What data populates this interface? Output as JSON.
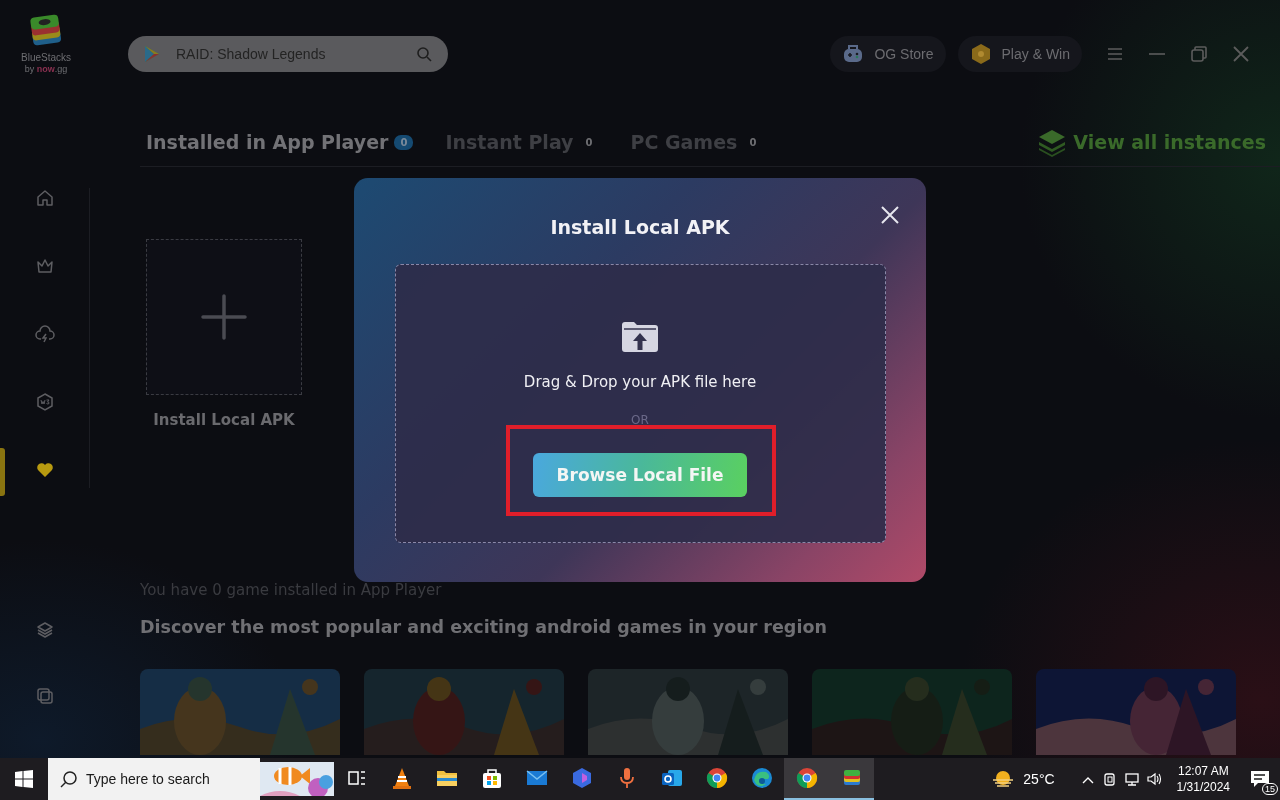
{
  "app": {
    "logo_name": "BlueStacks",
    "logo_by": "by **now**.gg"
  },
  "search": {
    "value": "RAID: Shadow Legends"
  },
  "header_buttons": [
    {
      "label": "OG Store",
      "kind": "store"
    },
    {
      "label": "Play & Win",
      "kind": "reward"
    }
  ],
  "window_controls": [
    {
      "kind": "menu"
    },
    {
      "kind": "minimize"
    },
    {
      "kind": "restore"
    },
    {
      "kind": "close"
    }
  ],
  "tabs": [
    {
      "label": "Installed in App Player",
      "count": "0",
      "selected": true
    },
    {
      "label": "Instant Play",
      "count": "0",
      "selected": false
    },
    {
      "label": "PC Games",
      "count": "0",
      "selected": false
    }
  ],
  "view_all": "View all instances",
  "sidebar": {
    "items": [
      {
        "kind": "home",
        "selected": false
      },
      {
        "kind": "crown",
        "selected": false
      },
      {
        "kind": "cloud",
        "selected": false
      },
      {
        "kind": "w3",
        "selected": false
      },
      {
        "kind": "heart",
        "selected": true
      }
    ],
    "bottom_items": [
      {
        "kind": "layers"
      },
      {
        "kind": "copy"
      }
    ]
  },
  "install_tile": {
    "label": "Install Local APK"
  },
  "empty_message": "You have 0 game installed in App Player",
  "discover_heading": "Discover the most popular and exciting android games in your region",
  "dialog": {
    "title": "Install Local APK",
    "drop_text": "Drag & Drop your APK file here",
    "or_text": "OR",
    "button": "Browse Local File",
    "highlighted": true
  },
  "taskbar": {
    "search_placeholder": "Type here to search",
    "apps": [
      {
        "kind": "task-view",
        "active": false
      },
      {
        "kind": "cone",
        "active": false
      },
      {
        "kind": "folder",
        "active": false
      },
      {
        "kind": "store",
        "active": false
      },
      {
        "kind": "mail",
        "active": false
      },
      {
        "kind": "hexagon",
        "active": false
      },
      {
        "kind": "mic",
        "active": false
      },
      {
        "kind": "outlook",
        "active": false
      },
      {
        "kind": "chrome",
        "active": false
      },
      {
        "kind": "edge",
        "active": false
      },
      {
        "kind": "chrome",
        "active": true
      },
      {
        "kind": "stack",
        "active": true
      }
    ],
    "weather": "25°C",
    "time": "12:07 AM",
    "date": "1/31/2024",
    "notifications": "15"
  }
}
